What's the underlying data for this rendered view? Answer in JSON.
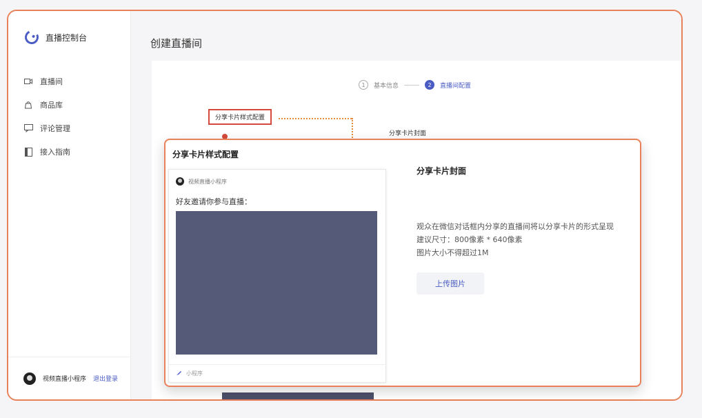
{
  "sidebar": {
    "logo_title": "直播控制台",
    "items": [
      {
        "label": "直播间",
        "icon": "video-icon"
      },
      {
        "label": "商品库",
        "icon": "bag-icon"
      },
      {
        "label": "评论管理",
        "icon": "comment-icon"
      },
      {
        "label": "接入指南",
        "icon": "doc-icon"
      }
    ],
    "footer": {
      "name": "视频直播小程序",
      "link": "退出登录"
    }
  },
  "main": {
    "page_title": "创建直播间",
    "steps": [
      {
        "num": "1",
        "label": "基本信息"
      },
      {
        "num": "2",
        "label": "直播间配置"
      }
    ],
    "tag_label": "分享卡片样式配置",
    "small_label": "分享卡片封面"
  },
  "zoom_panel": {
    "title": "分享卡片样式配置",
    "preview": {
      "user": "视频直播小程序",
      "text": "好友邀请你参与直播：",
      "footer": "小程序"
    },
    "cover": {
      "title": "分享卡片封面",
      "desc_lines": [
        "观众在微信对话框内分享的直播间将以分享卡片的形式呈现",
        "建议尺寸：800像素 * 640像素",
        "图片大小不得超过1M"
      ],
      "upload_label": "上传图片"
    }
  },
  "colors": {
    "accent": "#4b5cc4",
    "highlight": "#e8805a",
    "image": "#555a78"
  }
}
